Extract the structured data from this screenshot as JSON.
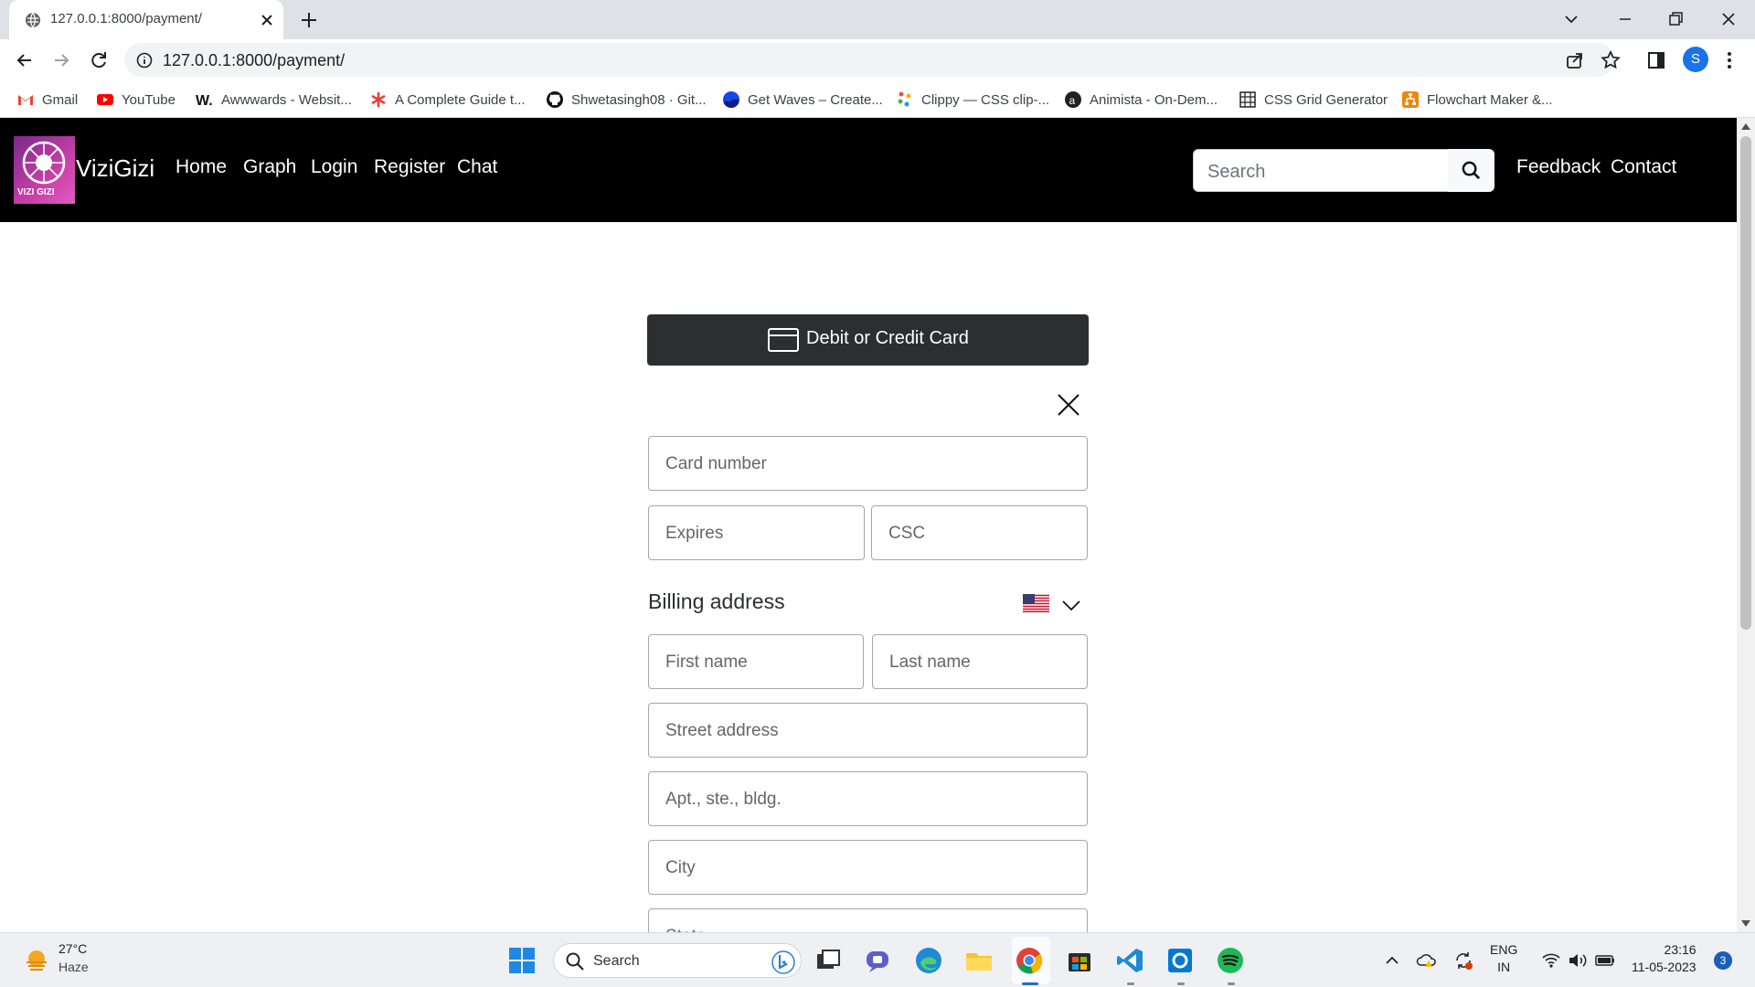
{
  "browser": {
    "tab_title": "127.0.0.1:8000/payment/",
    "url": "127.0.0.1:8000/payment/",
    "profile_initial": "S",
    "bookmarks": [
      {
        "label": "Gmail",
        "icon": "gmail-icon"
      },
      {
        "label": "YouTube",
        "icon": "youtube-icon"
      },
      {
        "label": "Awwwards - Websit...",
        "icon": "awwwards-icon"
      },
      {
        "label": "A Complete Guide t...",
        "icon": "asterisk-icon"
      },
      {
        "label": "Shwetasingh08 · Git...",
        "icon": "github-icon"
      },
      {
        "label": "Get Waves – Create...",
        "icon": "waves-icon"
      },
      {
        "label": "Clippy — CSS clip-...",
        "icon": "clippy-icon"
      },
      {
        "label": "Animista - On-Dem...",
        "icon": "animista-icon"
      },
      {
        "label": "CSS Grid Generator",
        "icon": "grid-icon"
      },
      {
        "label": "Flowchart Maker &...",
        "icon": "flowchart-icon"
      }
    ]
  },
  "site": {
    "logo_text": "VIZI GIZI",
    "brand": "ViziGizi",
    "nav": [
      "Home",
      "Graph",
      "Login",
      "Register",
      "Chat"
    ],
    "search_placeholder": "Search",
    "right_links": [
      "Feedback",
      "Contact"
    ]
  },
  "payment": {
    "card_button": "Debit or Credit Card",
    "card_number": "Card number",
    "expires": "Expires",
    "csc": "CSC",
    "billing_title": "Billing address",
    "first_name": "First name",
    "last_name": "Last name",
    "street": "Street address",
    "apt": "Apt., ste., bldg.",
    "city": "City",
    "state": "State"
  },
  "taskbar": {
    "temperature": "27°C",
    "weather": "Haze",
    "search": "Search",
    "lang_top": "ENG",
    "lang_bottom": "IN",
    "time": "23:16",
    "date": "11-05-2023",
    "notifications": "3"
  },
  "colors": {
    "site_nav_bg": "#000000",
    "card_button_bg": "#2c2e2f",
    "browser_tabbar": "#dee1e6",
    "taskbar_bg": "#eef0f4"
  }
}
